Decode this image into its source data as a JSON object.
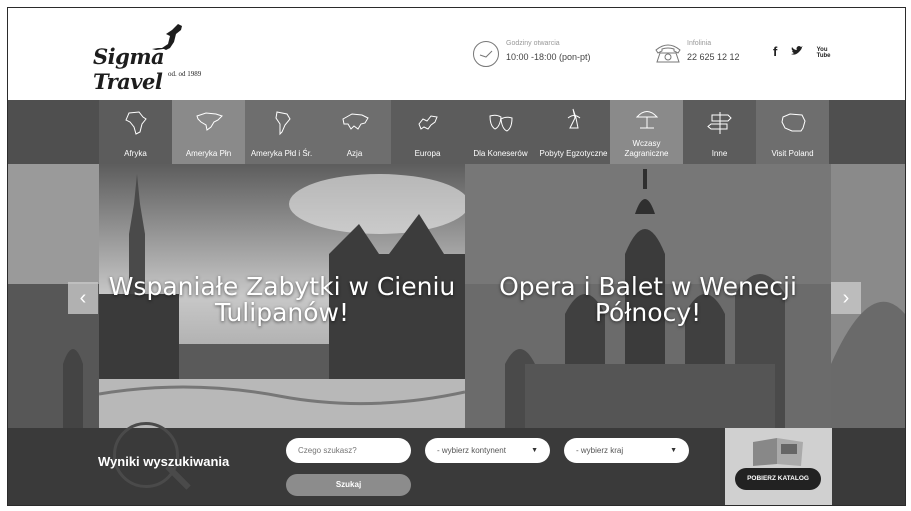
{
  "header": {
    "logo": {
      "brand": "Sigma Travel",
      "since": "od. od 1989"
    },
    "hours": {
      "label": "Godziny otwarcia",
      "value": "10:00 -18:00 (pon-pt)"
    },
    "phone": {
      "label": "Infolinia",
      "value": "22 625 12 12"
    },
    "social": {
      "facebook": "f",
      "twitter": "t",
      "youtube": "You Tube"
    }
  },
  "nav": {
    "items": [
      {
        "label": "Afryka",
        "icon": "africa-icon"
      },
      {
        "label": "Ameryka Płn",
        "icon": "north-america-icon"
      },
      {
        "label": "Ameryka Płd i Śr.",
        "icon": "south-america-icon"
      },
      {
        "label": "Azja",
        "icon": "asia-icon"
      },
      {
        "label": "Europa",
        "icon": "europe-icon"
      },
      {
        "label": "Dla Koneserów",
        "icon": "masks-icon"
      },
      {
        "label": "Pobyty Egzotyczne",
        "icon": "exotic-icon"
      },
      {
        "label": "Wczasy Zagraniczne",
        "icon": "umbrella-icon"
      },
      {
        "label": "Inne",
        "icon": "signpost-icon"
      },
      {
        "label": "Visit Poland",
        "icon": "poland-icon"
      }
    ]
  },
  "slider": {
    "slides": [
      {
        "title": "Wspaniałe Zabytki w Cieniu Tulipanów!"
      },
      {
        "title": "Opera i Balet w Wenecji Północy!"
      }
    ],
    "prev": "‹",
    "next": "›"
  },
  "search": {
    "title": "Wyniki wyszukiwania",
    "query_placeholder": "Czego szukasz?",
    "continent": "- wybierz kontynent",
    "country": "- wybierz kraj",
    "button": "Szukaj",
    "catalog_button": "POBIERZ KATALOG"
  }
}
